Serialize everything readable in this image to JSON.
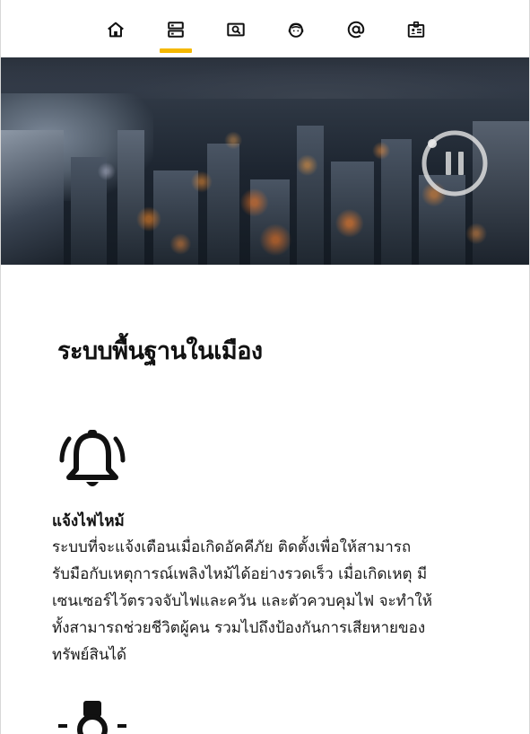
{
  "nav": {
    "items": [
      {
        "icon": "home-icon"
      },
      {
        "icon": "server-icon",
        "active": true
      },
      {
        "icon": "search-monitor-icon"
      },
      {
        "icon": "support-agent-icon"
      },
      {
        "icon": "at-sign-icon"
      },
      {
        "icon": "id-card-icon"
      }
    ],
    "accent_color": "#f5b800"
  },
  "hero": {
    "pause_icon": "pause-icon"
  },
  "section": {
    "title": "ระบบพื้นฐานในเมือง"
  },
  "features": [
    {
      "icon": "bell-icon",
      "title": "แจ้งไฟไหม้",
      "description": "ระบบที่จะแจ้งเตือนเมื่อเกิดอัคคีภัย ติดตั้งเพื่อให้สามารถรับมือกับเหตุการณ์เพลิงไหม้ได้อย่างรวดเร็ว เมื่อเกิดเหตุ มีเซนเซอร์ไว้ตรวจจับไฟและควัน และตัวควบคุมไฟ จะทำให้ทั้งสามารถช่วยชีวิตผู้คน รวมไปถึงป้องกันการเสียหายของทรัพย์สินได้"
    },
    {
      "icon": "security-guard-icon"
    }
  ]
}
